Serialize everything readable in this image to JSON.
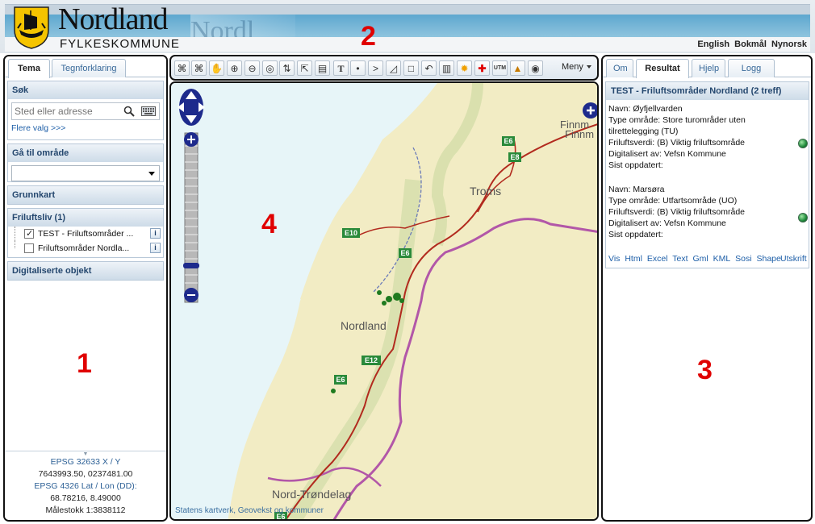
{
  "header": {
    "title": "Nordland",
    "subtitle": "FYLKESKOMMUNE",
    "watermark": "Nordl",
    "languages": [
      "English",
      "Bokmål",
      "Nynorsk"
    ]
  },
  "annotations": [
    "1",
    "2",
    "3",
    "4"
  ],
  "left_panel": {
    "tabs": [
      "Tema",
      "Tegnforklaring"
    ],
    "search": {
      "heading": "Søk",
      "placeholder": "Sted eller adresse",
      "more_options": "Flere valg >>>"
    },
    "goto": {
      "heading": "Gå til område",
      "selected": ""
    },
    "base_map": {
      "heading": "Grunnkart"
    },
    "outdoor": {
      "heading": "Friluftsliv (1)",
      "layers": [
        {
          "label": "TEST - Friluftsområder ...",
          "checked": true
        },
        {
          "label": "Friluftsområder Nordla...",
          "checked": false
        }
      ]
    },
    "digitized": {
      "heading": "Digitaliserte objekt"
    },
    "coords": {
      "epsg1_label": "EPSG 32633 X / Y",
      "epsg1_value": "7643993.50, 0237481.00",
      "epsg2_label": "EPSG 4326 Lat / Lon (DD):",
      "epsg2_value": "68.78216, 8.49000",
      "scale": "Målestokk 1:3838112"
    }
  },
  "toolbar": {
    "tools": [
      "binoculars-icon",
      "binoculars2-icon",
      "pan-hand-icon",
      "zoom-in-icon",
      "zoom-out-icon",
      "zoom-extent-icon",
      "rotate-icon",
      "move-icon",
      "print-icon",
      "text-icon",
      "point-icon",
      "line-icon",
      "polygon-icon",
      "rectangle-icon",
      "undo-icon",
      "list-icon",
      "sun-icon",
      "cross-icon",
      "utm-icon",
      "landscape-icon",
      "camera-icon"
    ],
    "menu_label": "Meny"
  },
  "map": {
    "labels": {
      "troms": "Troms",
      "nordland": "Nordland",
      "nord_trondelag": "Nord-Trøndelag",
      "finnmark1": "Finnm",
      "finnmark2": "Finnm"
    },
    "road_shields": [
      "E6",
      "E8",
      "E10",
      "E6",
      "E12",
      "E6",
      "E6"
    ],
    "attribution": "Statens kartverk, Geovekst og kommuner"
  },
  "right_panel": {
    "tabs": [
      "Om",
      "Resultat",
      "Hjelp",
      "Logg inn"
    ],
    "result_title": "TEST - Friluftsområder Nordland (2 treff)",
    "records": [
      {
        "navn": "Navn: Øyfjellvarden",
        "type1": "Type område: Store turområder uten",
        "type2": "tilrettelegging (TU)",
        "verdi": "Friluftsverdi: (B) Viktig friluftsområde",
        "dig": "Digitalisert av: Vefsn Kommune",
        "sist": "Sist oppdatert:"
      },
      {
        "navn": "Navn: Marsøra",
        "type1": "Type område: Utfartsområde (UO)",
        "verdi": "Friluftsverdi: (B) Viktig friluftsområde",
        "dig": "Digitalisert av: Vefsn Kommune",
        "sist": "Sist oppdatert:"
      }
    ],
    "export_links": [
      "Vis",
      "Html",
      "Excel",
      "Text",
      "Gml",
      "KML",
      "Sosi",
      "Shape"
    ],
    "print": "Utskrift"
  },
  "colors": {
    "accent": "#24476e",
    "link": "#1e5fa8",
    "annotation": "#e00000",
    "sea": "#e7f5f8",
    "land": "#f2ecc4",
    "border": "#b257a8"
  }
}
